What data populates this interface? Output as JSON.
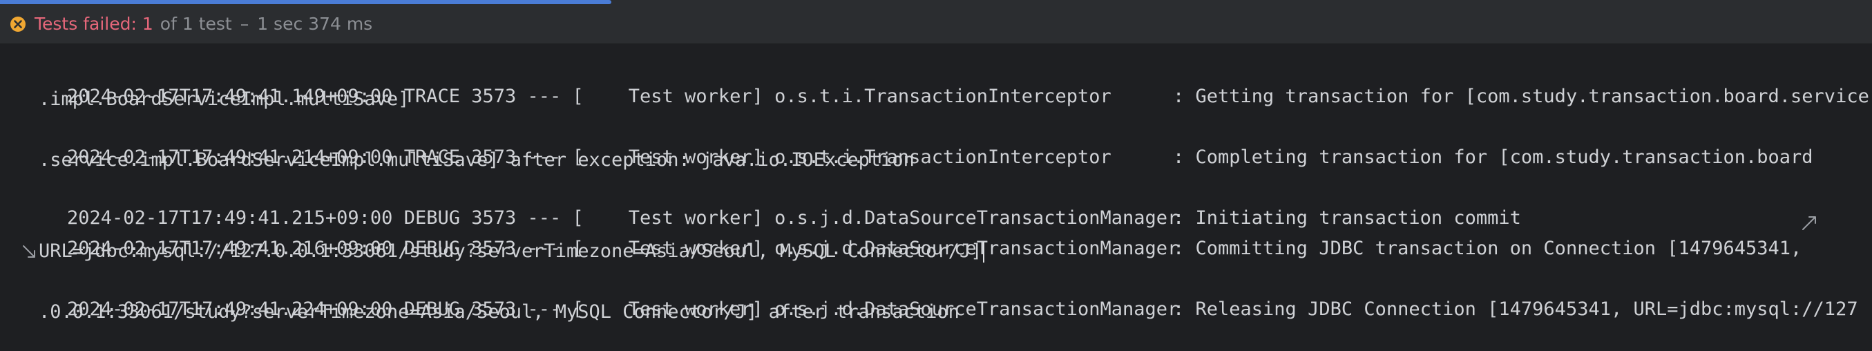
{
  "status": {
    "fail_label": "Tests failed:",
    "fail_count": "1",
    "total_text": "of 1 test",
    "separator": "–",
    "duration": "1 sec 374 ms",
    "icon": "fail-circle-x-icon",
    "progress_fraction": 0.33
  },
  "log": {
    "lines": [
      {
        "prefix": "2024-02-17T17:49:41.149+09:00 TRACE 3573 --- [    Test worker] o.s.t.i.TransactionInterceptor",
        "message": ": Getting transaction for [com.study.transaction.board.service",
        "continuation": ".impl.BoardServiceImpl.multiSave]"
      },
      {
        "prefix": "2024-02-17T17:49:41.214+09:00 TRACE 3573 --- [    Test worker] o.s.t.i.TransactionInterceptor",
        "message": ": Completing transaction for [com.study.transaction.board",
        "continuation": ".service.impl.BoardServiceImpl.multiSave] after exception: java.io.IOException"
      },
      {
        "prefix": "2024-02-17T17:49:41.215+09:00 DEBUG 3573 --- [    Test worker] o.s.j.d.DataSourceTransactionManager",
        "message": ": Initiating transaction commit"
      },
      {
        "prefix": "2024-02-17T17:49:41.216+09:00 DEBUG 3573 --- [    Test worker] o.s.j.d.DataSourceTransactionManager",
        "message": ": Committing JDBC transaction on Connection [1479645341,",
        "continuation": "URL=jdbc:mysql://127.0.0.1:33061/study?serverTimezone=Asia/Seoul, MySQL Connector/J]"
      },
      {
        "prefix": "2024-02-17T17:49:41.224+09:00 DEBUG 3573 --- [    Test worker] o.s.j.d.DataSourceTransactionManager",
        "message": ": Releasing JDBC Connection [1479645341, URL=jdbc:mysql://127",
        "continuation": ".0.0.1:33061/study?serverTimezone=Asia/Seoul, MySQL Connector/J] after transaction"
      }
    ]
  },
  "icons": {
    "soft_wrap_end": "soft-wrap-arrow-icon",
    "soft_wrap_start": "soft-wrap-return-icon"
  },
  "colors": {
    "fail": "#e5677a",
    "muted": "#8c8f94",
    "log_text": "#cfd1d5",
    "background": "#1e1f22",
    "progress": "#4a7cd6"
  }
}
